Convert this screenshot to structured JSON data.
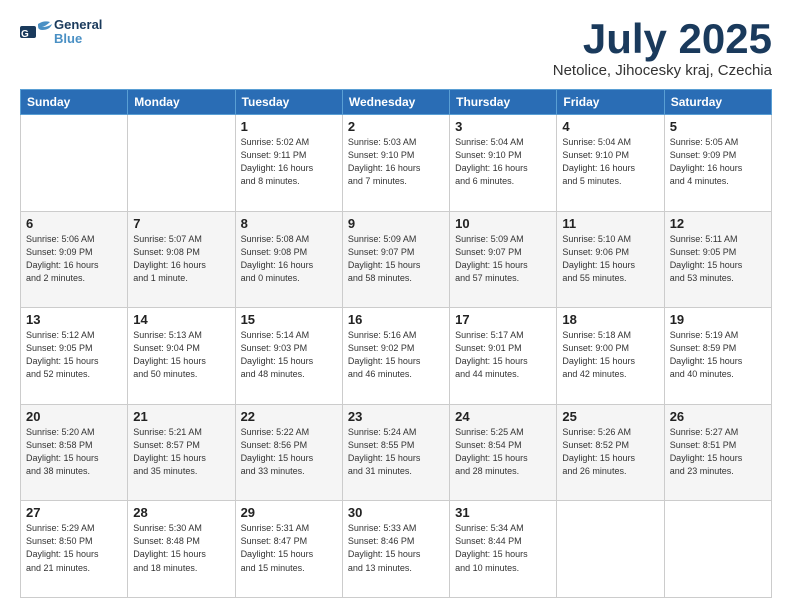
{
  "header": {
    "logo_general": "General",
    "logo_blue": "Blue",
    "month_title": "July 2025",
    "subtitle": "Netolice, Jihocesky kraj, Czechia"
  },
  "days_of_week": [
    "Sunday",
    "Monday",
    "Tuesday",
    "Wednesday",
    "Thursday",
    "Friday",
    "Saturday"
  ],
  "weeks": [
    [
      {
        "day": "",
        "info": ""
      },
      {
        "day": "",
        "info": ""
      },
      {
        "day": "1",
        "info": "Sunrise: 5:02 AM\nSunset: 9:11 PM\nDaylight: 16 hours\nand 8 minutes."
      },
      {
        "day": "2",
        "info": "Sunrise: 5:03 AM\nSunset: 9:10 PM\nDaylight: 16 hours\nand 7 minutes."
      },
      {
        "day": "3",
        "info": "Sunrise: 5:04 AM\nSunset: 9:10 PM\nDaylight: 16 hours\nand 6 minutes."
      },
      {
        "day": "4",
        "info": "Sunrise: 5:04 AM\nSunset: 9:10 PM\nDaylight: 16 hours\nand 5 minutes."
      },
      {
        "day": "5",
        "info": "Sunrise: 5:05 AM\nSunset: 9:09 PM\nDaylight: 16 hours\nand 4 minutes."
      }
    ],
    [
      {
        "day": "6",
        "info": "Sunrise: 5:06 AM\nSunset: 9:09 PM\nDaylight: 16 hours\nand 2 minutes."
      },
      {
        "day": "7",
        "info": "Sunrise: 5:07 AM\nSunset: 9:08 PM\nDaylight: 16 hours\nand 1 minute."
      },
      {
        "day": "8",
        "info": "Sunrise: 5:08 AM\nSunset: 9:08 PM\nDaylight: 16 hours\nand 0 minutes."
      },
      {
        "day": "9",
        "info": "Sunrise: 5:09 AM\nSunset: 9:07 PM\nDaylight: 15 hours\nand 58 minutes."
      },
      {
        "day": "10",
        "info": "Sunrise: 5:09 AM\nSunset: 9:07 PM\nDaylight: 15 hours\nand 57 minutes."
      },
      {
        "day": "11",
        "info": "Sunrise: 5:10 AM\nSunset: 9:06 PM\nDaylight: 15 hours\nand 55 minutes."
      },
      {
        "day": "12",
        "info": "Sunrise: 5:11 AM\nSunset: 9:05 PM\nDaylight: 15 hours\nand 53 minutes."
      }
    ],
    [
      {
        "day": "13",
        "info": "Sunrise: 5:12 AM\nSunset: 9:05 PM\nDaylight: 15 hours\nand 52 minutes."
      },
      {
        "day": "14",
        "info": "Sunrise: 5:13 AM\nSunset: 9:04 PM\nDaylight: 15 hours\nand 50 minutes."
      },
      {
        "day": "15",
        "info": "Sunrise: 5:14 AM\nSunset: 9:03 PM\nDaylight: 15 hours\nand 48 minutes."
      },
      {
        "day": "16",
        "info": "Sunrise: 5:16 AM\nSunset: 9:02 PM\nDaylight: 15 hours\nand 46 minutes."
      },
      {
        "day": "17",
        "info": "Sunrise: 5:17 AM\nSunset: 9:01 PM\nDaylight: 15 hours\nand 44 minutes."
      },
      {
        "day": "18",
        "info": "Sunrise: 5:18 AM\nSunset: 9:00 PM\nDaylight: 15 hours\nand 42 minutes."
      },
      {
        "day": "19",
        "info": "Sunrise: 5:19 AM\nSunset: 8:59 PM\nDaylight: 15 hours\nand 40 minutes."
      }
    ],
    [
      {
        "day": "20",
        "info": "Sunrise: 5:20 AM\nSunset: 8:58 PM\nDaylight: 15 hours\nand 38 minutes."
      },
      {
        "day": "21",
        "info": "Sunrise: 5:21 AM\nSunset: 8:57 PM\nDaylight: 15 hours\nand 35 minutes."
      },
      {
        "day": "22",
        "info": "Sunrise: 5:22 AM\nSunset: 8:56 PM\nDaylight: 15 hours\nand 33 minutes."
      },
      {
        "day": "23",
        "info": "Sunrise: 5:24 AM\nSunset: 8:55 PM\nDaylight: 15 hours\nand 31 minutes."
      },
      {
        "day": "24",
        "info": "Sunrise: 5:25 AM\nSunset: 8:54 PM\nDaylight: 15 hours\nand 28 minutes."
      },
      {
        "day": "25",
        "info": "Sunrise: 5:26 AM\nSunset: 8:52 PM\nDaylight: 15 hours\nand 26 minutes."
      },
      {
        "day": "26",
        "info": "Sunrise: 5:27 AM\nSunset: 8:51 PM\nDaylight: 15 hours\nand 23 minutes."
      }
    ],
    [
      {
        "day": "27",
        "info": "Sunrise: 5:29 AM\nSunset: 8:50 PM\nDaylight: 15 hours\nand 21 minutes."
      },
      {
        "day": "28",
        "info": "Sunrise: 5:30 AM\nSunset: 8:48 PM\nDaylight: 15 hours\nand 18 minutes."
      },
      {
        "day": "29",
        "info": "Sunrise: 5:31 AM\nSunset: 8:47 PM\nDaylight: 15 hours\nand 15 minutes."
      },
      {
        "day": "30",
        "info": "Sunrise: 5:33 AM\nSunset: 8:46 PM\nDaylight: 15 hours\nand 13 minutes."
      },
      {
        "day": "31",
        "info": "Sunrise: 5:34 AM\nSunset: 8:44 PM\nDaylight: 15 hours\nand 10 minutes."
      },
      {
        "day": "",
        "info": ""
      },
      {
        "day": "",
        "info": ""
      }
    ]
  ]
}
